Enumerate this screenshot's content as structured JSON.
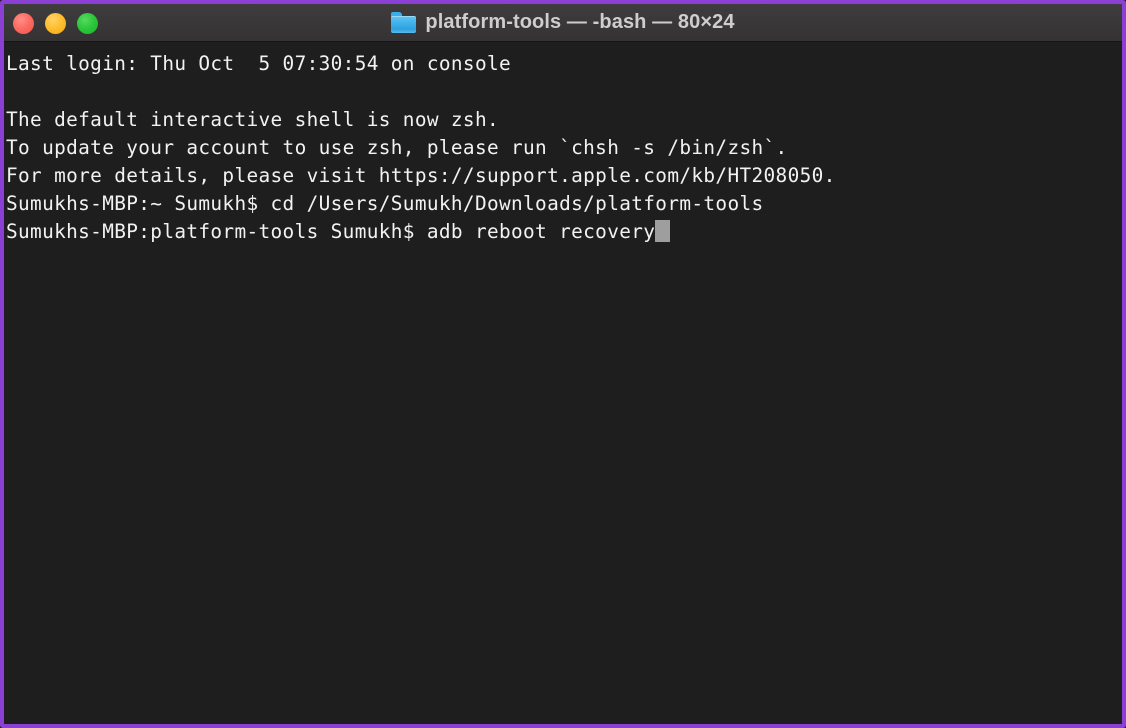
{
  "window": {
    "title": "platform-tools — -bash — 80×24",
    "folder_icon": "folder-icon",
    "border_color": "#8b3fd4",
    "titlebar_color": "#393738",
    "controls": {
      "close_label": "",
      "minimize_label": "",
      "maximize_label": ""
    }
  },
  "terminal": {
    "background": "#1e1e1e",
    "foreground": "#f2f2f2",
    "cursor_color": "#9e9e9e",
    "columns": 80,
    "rows": 24,
    "lines": [
      "Last login: Thu Oct  5 07:30:54 on console",
      "",
      "The default interactive shell is now zsh.",
      "To update your account to use zsh, please run `chsh -s /bin/zsh`.",
      "For more details, please visit https://support.apple.com/kb/HT208050.",
      "Sumukhs-MBP:~ Sumukh$ cd /Users/Sumukh/Downloads/platform-tools",
      "Sumukhs-MBP:platform-tools Sumukh$ adb reboot recovery"
    ],
    "last_login": {
      "day": "Thu",
      "month": "Oct",
      "date": "5",
      "time": "07:30:54",
      "tty": "console"
    },
    "commands": [
      {
        "prompt": "Sumukhs-MBP:~ Sumukh$",
        "command": "cd /Users/Sumukh/Downloads/platform-tools"
      },
      {
        "prompt": "Sumukhs-MBP:platform-tools Sumukh$",
        "command": "adb reboot recovery"
      }
    ]
  }
}
